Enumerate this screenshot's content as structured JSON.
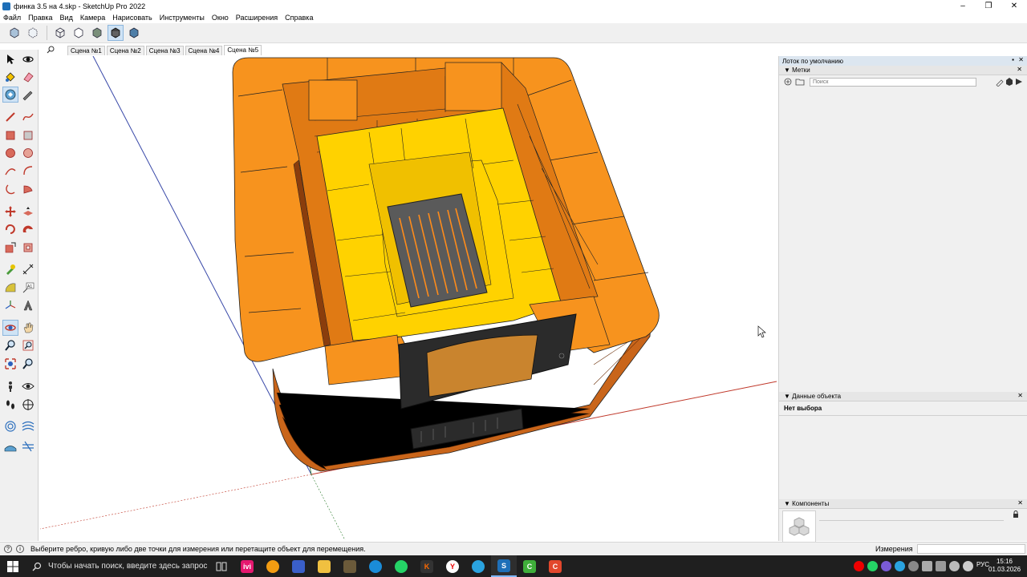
{
  "window": {
    "title": "финка 3.5 на 4.skp - SketchUp Pro 2022",
    "controls": [
      "–",
      "❐",
      "✕"
    ]
  },
  "menu": [
    "Файл",
    "Правка",
    "Вид",
    "Камера",
    "Нарисовать",
    "Инструменты",
    "Окно",
    "Расширения",
    "Справка"
  ],
  "scenes": {
    "tabs": [
      "Сцена №1",
      "Сцена №2",
      "Сцена №3",
      "Сцена №4",
      "Сцена №5"
    ],
    "active_index": 4
  },
  "tray": {
    "title": "Лоток по умолчанию",
    "tags": {
      "header": "Метки",
      "search_placeholder": "Поиск"
    },
    "entity_info": {
      "header": "Данные объекта",
      "status": "Нет выбора"
    },
    "components": {
      "header": "Компоненты"
    }
  },
  "status": {
    "message": "Выберите ребро, кривую либо две точки для измерения или перетащите объект для перемещения.",
    "measurements_label": "Измерения",
    "measurements_value": ""
  },
  "taskbar": {
    "search_text": "Чтобы начать поиск, введите здесь запрос",
    "language": "РУС",
    "time": "15:16",
    "date": "01.03.2026"
  },
  "colors": {
    "brick_orange": "#f7931e",
    "firebrick_yellow": "#ffd200",
    "cast_iron": "#2b2b2b",
    "accent_blue": "#1e6fb8"
  }
}
